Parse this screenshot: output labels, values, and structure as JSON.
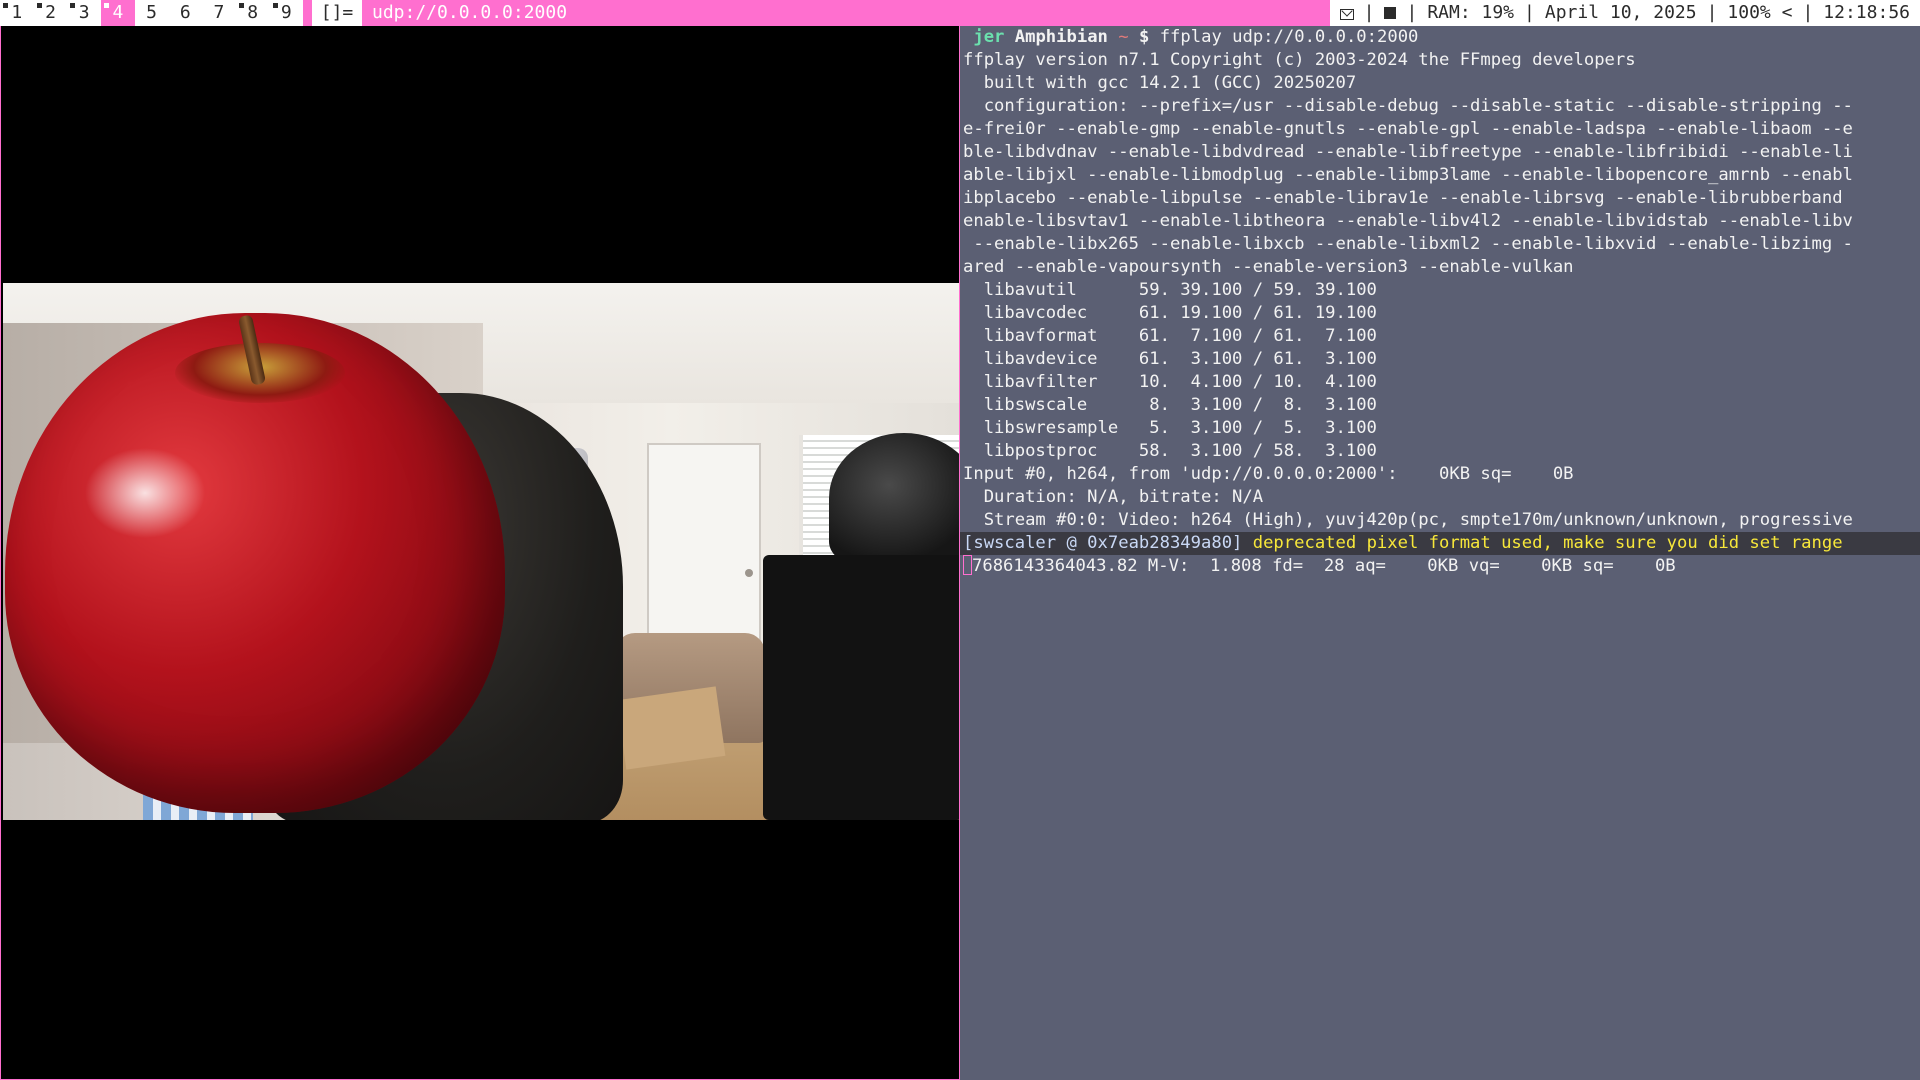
{
  "bar": {
    "tags": [
      "1",
      "2",
      "3",
      "4",
      "5",
      "6",
      "7",
      "8",
      "9"
    ],
    "occupied_tags": [
      "1",
      "2",
      "3",
      "4",
      "8",
      "9"
    ],
    "selected_tag": "4",
    "layout_symbol": "[]=",
    "window_title": "udp://0.0.0.0:2000",
    "status": {
      "mail_icon": "mail-icon",
      "square_icon": "square-icon",
      "ram": "RAM: 19%",
      "date": "April 10, 2025",
      "battery": "100% <",
      "time": "12:18:56",
      "separator": "|"
    },
    "colors": {
      "accent": "#ff6fcf",
      "bar_bg": "#ffffff",
      "bar_fg": "#2b2b2b"
    }
  },
  "video": {
    "window": "ffplay video output",
    "content_icons": [
      "apple",
      "room-scene"
    ]
  },
  "terminal": {
    "background": "#5b5f73",
    "prompt": {
      "user": "jer",
      "host": "Amphibian",
      "dir": "~",
      "symbol": "$",
      "command": "ffplay udp://0.0.0.0:2000"
    },
    "lines": [
      "ffplay version n7.1 Copyright (c) 2003-2024 the FFmpeg developers",
      "  built with gcc 14.2.1 (GCC) 20250207",
      "  configuration: --prefix=/usr --disable-debug --disable-static --disable-stripping --",
      "e-frei0r --enable-gmp --enable-gnutls --enable-gpl --enable-ladspa --enable-libaom --e",
      "ble-libdvdnav --enable-libdvdread --enable-libfreetype --enable-libfribidi --enable-li",
      "able-libjxl --enable-libmodplug --enable-libmp3lame --enable-libopencore_amrnb --enabl",
      "ibplacebo --enable-libpulse --enable-librav1e --enable-librsvg --enable-librubberband",
      "enable-libsvtav1 --enable-libtheora --enable-libv4l2 --enable-libvidstab --enable-libv",
      " --enable-libx265 --enable-libxcb --enable-libxml2 --enable-libxvid --enable-libzimg -",
      "ared --enable-vapoursynth --enable-version3 --enable-vulkan",
      "  libavutil      59. 39.100 / 59. 39.100",
      "  libavcodec     61. 19.100 / 61. 19.100",
      "  libavformat    61.  7.100 / 61.  7.100",
      "  libavdevice    61.  3.100 / 61.  3.100",
      "  libavfilter    10.  4.100 / 10.  4.100",
      "  libswscale      8.  3.100 /  8.  3.100",
      "  libswresample   5.  3.100 /  5.  3.100",
      "  libpostproc    58.  3.100 / 58.  3.100",
      "Input #0, h264, from 'udp://0.0.0.0:2000':    0KB sq=    0B",
      "  Duration: N/A, bitrate: N/A",
      "  Stream #0:0: Video: h264 (High), yuvj420p(pc, smpte170m/unknown/unknown, progressive"
    ],
    "swscaler_tag": "[swscaler @ 0x7eab28349a80]",
    "swscaler_msg": " deprecated pixel format used, make sure you did set range",
    "status_line": "7686143364043.82 M-V:  1.808 fd=  28 aq=    0KB vq=    0KB sq=    0B"
  }
}
